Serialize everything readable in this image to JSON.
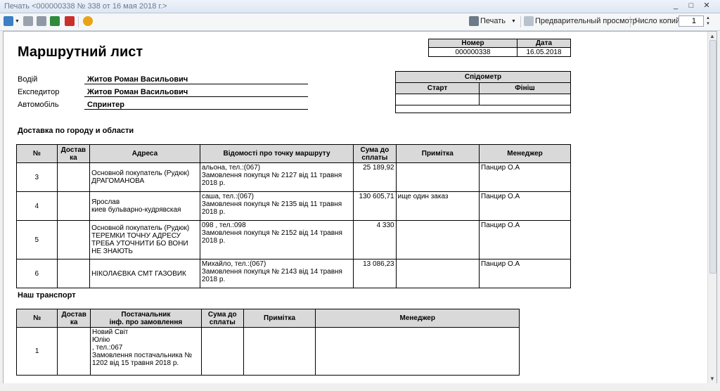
{
  "window": {
    "title": "Печать <000000338 № 338 от 16 мая 2018 г.>"
  },
  "toolbar": {
    "print_label": "Печать",
    "preview_label": "Предварительный просмотр",
    "copies_label": "Число копий",
    "copies_value": "1"
  },
  "doc": {
    "title": "Маршрутний лист",
    "number_header": "Номер",
    "date_header": "Дата",
    "number": "000000338",
    "date": "16.05.2018",
    "driver_label": "Водій",
    "driver": "Житов Роман Васильович",
    "forwarder_label": "Експедитор",
    "forwarder": "Житов Роман Васильович",
    "car_label": "Автомобіль",
    "car": "Спринтер",
    "speedometer": "Спідометр",
    "start": "Старт",
    "finish": "Фініш",
    "section1": "Доставка по городу и области",
    "section2": "Наш транспорт"
  },
  "delivery": {
    "headers": [
      "№",
      "Достав ка",
      "Адреса",
      "Відомості про точку маршруту",
      "Сума до сплаты",
      "Примітка",
      "Менеджер"
    ],
    "rows": [
      {
        "no": "3",
        "address": "Основной покупатель (Рудюк) ДРАГОМАНОВА",
        "info": "альона, тел.:(067)\nЗамовлення покупця № 2127 від 11 травня 2018 р.",
        "sum": "25 189,92",
        "note": "",
        "manager": "Панцир О.А"
      },
      {
        "no": "4",
        "address": "Ярослав\nкиев бульварно-кудрявская",
        "info": "саша, тел.:(067)\nЗамовлення покупця № 2135 від 11 травня 2018 р.",
        "sum": "130 605,71",
        "note": "ище один заказ",
        "manager": "Панцир О.А"
      },
      {
        "no": "5",
        "address": "Основной покупатель (Рудюк) ТЕРЕМКИ ТОЧНУ АДРЕСУ ТРЕБА УТОЧНИТИ БО ВОНИ НЕ ЗНАЮТЬ",
        "info": "098              , тел.:098\nЗамовлення покупця № 2152 від 14 травня 2018 р.",
        "sum": "4 330",
        "note": "",
        "manager": "Панцир О.А"
      },
      {
        "no": "6",
        "address": "НІКОЛАЄВКА  СМТ ГАЗОВИК",
        "info": "Михайло, тел.:(067)\nЗамовлення покупця № 2143 від 14 травня 2018 р.",
        "sum": "13 086,23",
        "note": "",
        "manager": "Панцир О.А"
      }
    ]
  },
  "transport": {
    "headers": [
      "№",
      "Достав ка",
      "Постачальник\nінф. про замовлення",
      "Сума до сплаты",
      "Примітка",
      "Менеджер"
    ],
    "rows": [
      {
        "no": "1",
        "supplier": "Новий Світ\n           Юлію\n, тел.:067\nЗамовлення постачальника № 1202 від 15 травня 2018 р.",
        "sum": "",
        "note": "",
        "manager": ""
      }
    ]
  }
}
